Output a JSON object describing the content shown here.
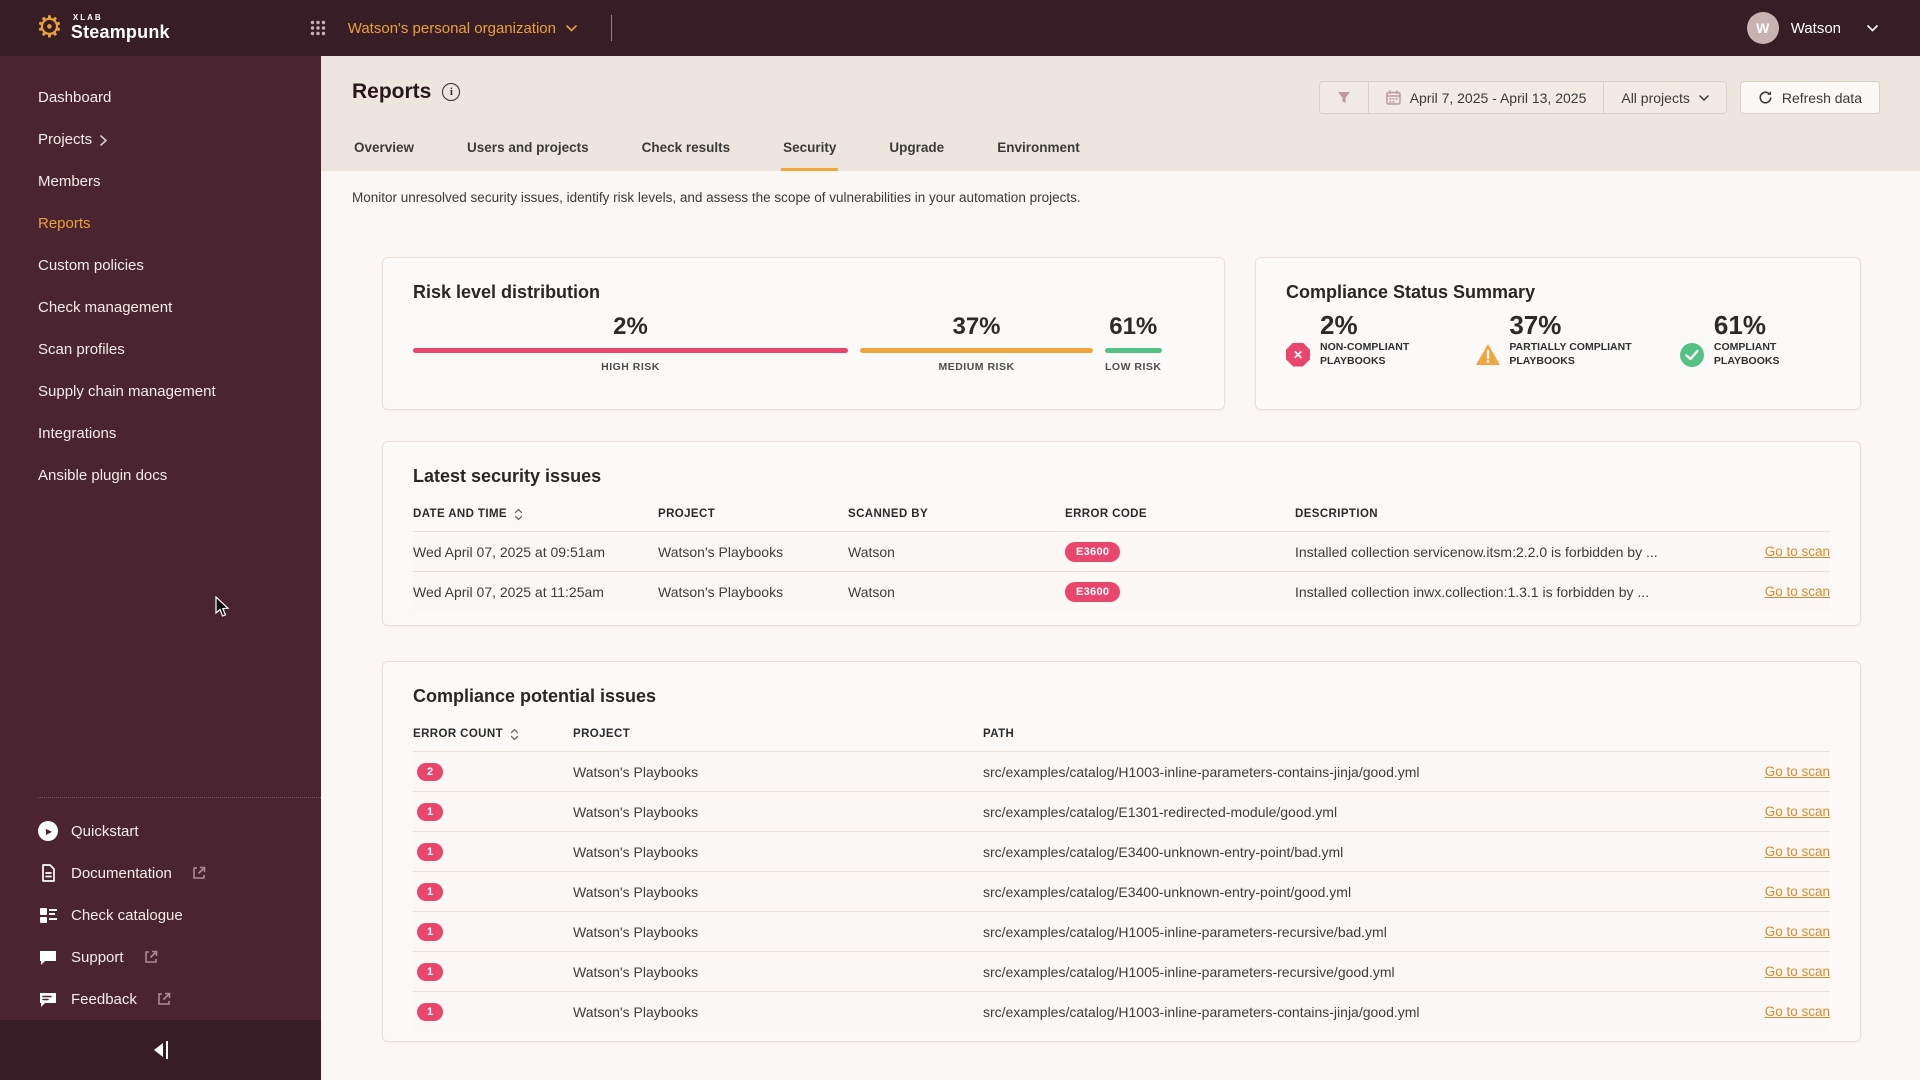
{
  "brand": {
    "xlab": "XLAB",
    "name": "Steampunk"
  },
  "topbar": {
    "org_name": "Watson's personal organization",
    "user_initial": "W",
    "user_name": "Watson"
  },
  "sidebar": {
    "items": [
      {
        "label": "Dashboard"
      },
      {
        "label": "Projects",
        "chevron": true
      },
      {
        "label": "Members"
      },
      {
        "label": "Reports",
        "active": true
      },
      {
        "label": "Custom policies"
      },
      {
        "label": "Check management"
      },
      {
        "label": "Scan profiles"
      },
      {
        "label": "Supply chain management"
      },
      {
        "label": "Integrations"
      },
      {
        "label": "Ansible plugin docs"
      }
    ],
    "footer": {
      "quickstart": "Quickstart",
      "documentation": "Documentation",
      "check_catalogue": "Check catalogue",
      "support": "Support",
      "feedback": "Feedback"
    }
  },
  "header": {
    "title": "Reports",
    "tabs": [
      {
        "label": "Overview"
      },
      {
        "label": "Users and projects"
      },
      {
        "label": "Check results"
      },
      {
        "label": "Security",
        "active": true
      },
      {
        "label": "Upgrade"
      },
      {
        "label": "Environment"
      }
    ],
    "description": "Monitor unresolved security issues, identify risk levels, and assess the scope of vulnerabilities in your automation projects.",
    "filters": {
      "date_range": "April 7, 2025 - April 13, 2025",
      "project_filter": "All projects",
      "refresh_label": "Refresh data"
    }
  },
  "risk_card": {
    "title": "Risk level distribution",
    "items": [
      {
        "value": "2%",
        "label": "HIGH RISK",
        "color": "#E9456D"
      },
      {
        "value": "37%",
        "label": "MEDIUM RISK",
        "color": "#F0A63C"
      },
      {
        "value": "61%",
        "label": "LOW RISK",
        "color": "#55C285"
      }
    ]
  },
  "compliance_card": {
    "title": "Compliance Status Summary",
    "items": [
      {
        "value": "2%",
        "label": "NON-COMPLIANT PLAYBOOKS",
        "icon": "x-circle"
      },
      {
        "value": "37%",
        "label": "PARTIALLY COMPLIANT PLAYBOOKS",
        "icon": "warning-triangle"
      },
      {
        "value": "61%",
        "label": "COMPLIANT PLAYBOOKS",
        "icon": "check-circle"
      }
    ]
  },
  "security_issues": {
    "title": "Latest security issues",
    "columns": {
      "date": "DATE AND TIME",
      "project": "PROJECT",
      "scanned_by": "SCANNED BY",
      "error_code": "ERROR CODE",
      "description": "DESCRIPTION"
    },
    "rows": [
      {
        "date": "Wed April 07, 2025 at 09:51am",
        "project": "Watson's Playbooks",
        "scanned_by": "Watson",
        "error_code": "E3600",
        "description": "Installed collection servicenow.itsm:2.2.0 is forbidden by ...",
        "link": "Go to scan"
      },
      {
        "date": "Wed April 07, 2025 at 11:25am",
        "project": "Watson's Playbooks",
        "scanned_by": "Watson",
        "error_code": "E3600",
        "description": "Installed collection inwx.collection:1.3.1 is forbidden by ...",
        "link": "Go to scan"
      }
    ]
  },
  "compliance_issues": {
    "title": "Compliance potential issues",
    "columns": {
      "count": "ERROR COUNT",
      "project": "PROJECT",
      "path": "PATH"
    },
    "rows": [
      {
        "count": "2",
        "project": "Watson's Playbooks",
        "path": "src/examples/catalog/H1003-inline-parameters-contains-jinja/good.yml",
        "link": "Go to scan"
      },
      {
        "count": "1",
        "project": "Watson's Playbooks",
        "path": "src/examples/catalog/E1301-redirected-module/good.yml",
        "link": "Go to scan"
      },
      {
        "count": "1",
        "project": "Watson's Playbooks",
        "path": "src/examples/catalog/E3400-unknown-entry-point/bad.yml",
        "link": "Go to scan"
      },
      {
        "count": "1",
        "project": "Watson's Playbooks",
        "path": "src/examples/catalog/E3400-unknown-entry-point/good.yml",
        "link": "Go to scan"
      },
      {
        "count": "1",
        "project": "Watson's Playbooks",
        "path": "src/examples/catalog/H1005-inline-parameters-recursive/bad.yml",
        "link": "Go to scan"
      },
      {
        "count": "1",
        "project": "Watson's Playbooks",
        "path": "src/examples/catalog/H1005-inline-parameters-recursive/good.yml",
        "link": "Go to scan"
      },
      {
        "count": "1",
        "project": "Watson's Playbooks",
        "path": "src/examples/catalog/H1003-inline-parameters-contains-jinja/good.yml",
        "link": "Go to scan"
      }
    ]
  },
  "colors": {
    "accent_orange": "#F0A63C",
    "link_orange": "#D98A2B",
    "pink": "#E9456D",
    "green": "#55C285",
    "sidebar_maroon": "#4A2431",
    "topbar_maroon": "#371E26"
  }
}
